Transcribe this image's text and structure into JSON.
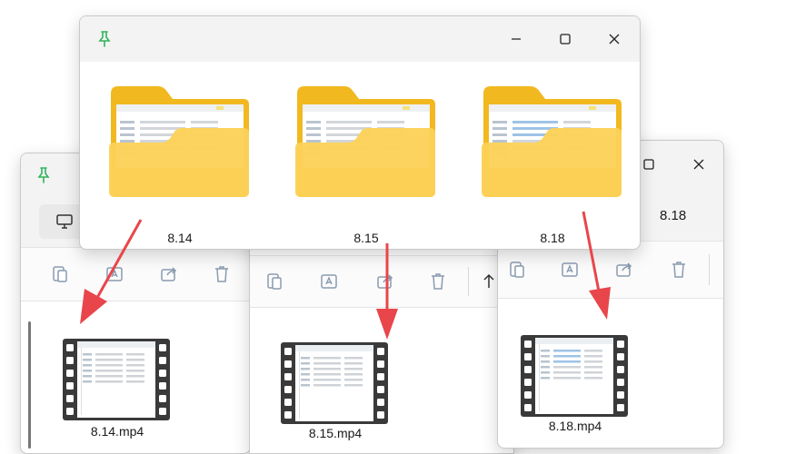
{
  "colors": {
    "pin": "#2fb45a",
    "folder_back": "#f2b81f",
    "folder_front": "#fcd157",
    "arrow": "#e8464b",
    "icon_gray": "#8a9bb0"
  },
  "window_left": {
    "pin_icon": "pin-icon",
    "nav_icon": "monitor-icon",
    "file": {
      "name": "8.14.mp4"
    }
  },
  "window_middle": {
    "file": {
      "name": "8.15.mp4"
    }
  },
  "window_right": {
    "breadcrumb": "8.18",
    "file": {
      "name": "8.18.mp4"
    }
  },
  "window_top": {
    "pin_icon": "pin-icon",
    "folders": [
      {
        "name": "8.14"
      },
      {
        "name": "8.15"
      },
      {
        "name": "8.18"
      }
    ]
  }
}
